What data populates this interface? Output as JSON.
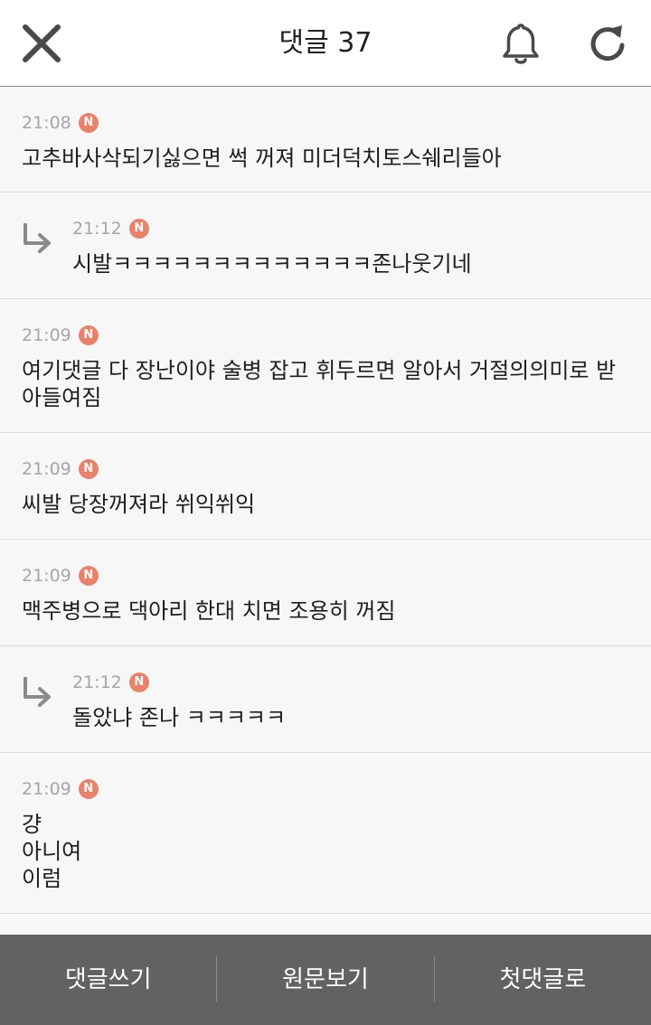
{
  "header": {
    "title": "댓글 37",
    "close_icon": "close-icon",
    "bell_icon": "bell-icon",
    "refresh_icon": "refresh-icon"
  },
  "comments": [
    {
      "time": "21:08",
      "badge": "N",
      "text": "고추바사삭되기싫으면 썩 꺼져 미더덕치토스쉐리들아",
      "reply": false
    },
    {
      "time": "21:12",
      "badge": "N",
      "text": "시발ㅋㅋㅋㅋㅋㅋㅋㅋㅋㅋㅋㅋㅋ존나웃기네",
      "reply": true
    },
    {
      "time": "21:09",
      "badge": "N",
      "text": "여기댓글 다 장난이야 술병 잡고 휘두르면 알아서 거절의의미로 받아들여짐",
      "reply": false
    },
    {
      "time": "21:09",
      "badge": "N",
      "text": "씨발 당장꺼져라 쒸익쒸익",
      "reply": false
    },
    {
      "time": "21:09",
      "badge": "N",
      "text": "맥주병으로 댁아리 한대 치면 조용히 꺼짐",
      "reply": false
    },
    {
      "time": "21:12",
      "badge": "N",
      "text": "돌았냐 존나 ㅋㅋㅋㅋㅋ",
      "reply": true
    },
    {
      "time": "21:09",
      "badge": "N",
      "text": "걍\n아니여\n이럼",
      "reply": false
    }
  ],
  "bottom_bar": {
    "write_label": "댓글쓰기",
    "original_label": "원문보기",
    "first_label": "첫댓글로"
  },
  "colors": {
    "badge": "#e8826a",
    "bottom_bar": "#626262",
    "time": "#a6a6a6"
  }
}
